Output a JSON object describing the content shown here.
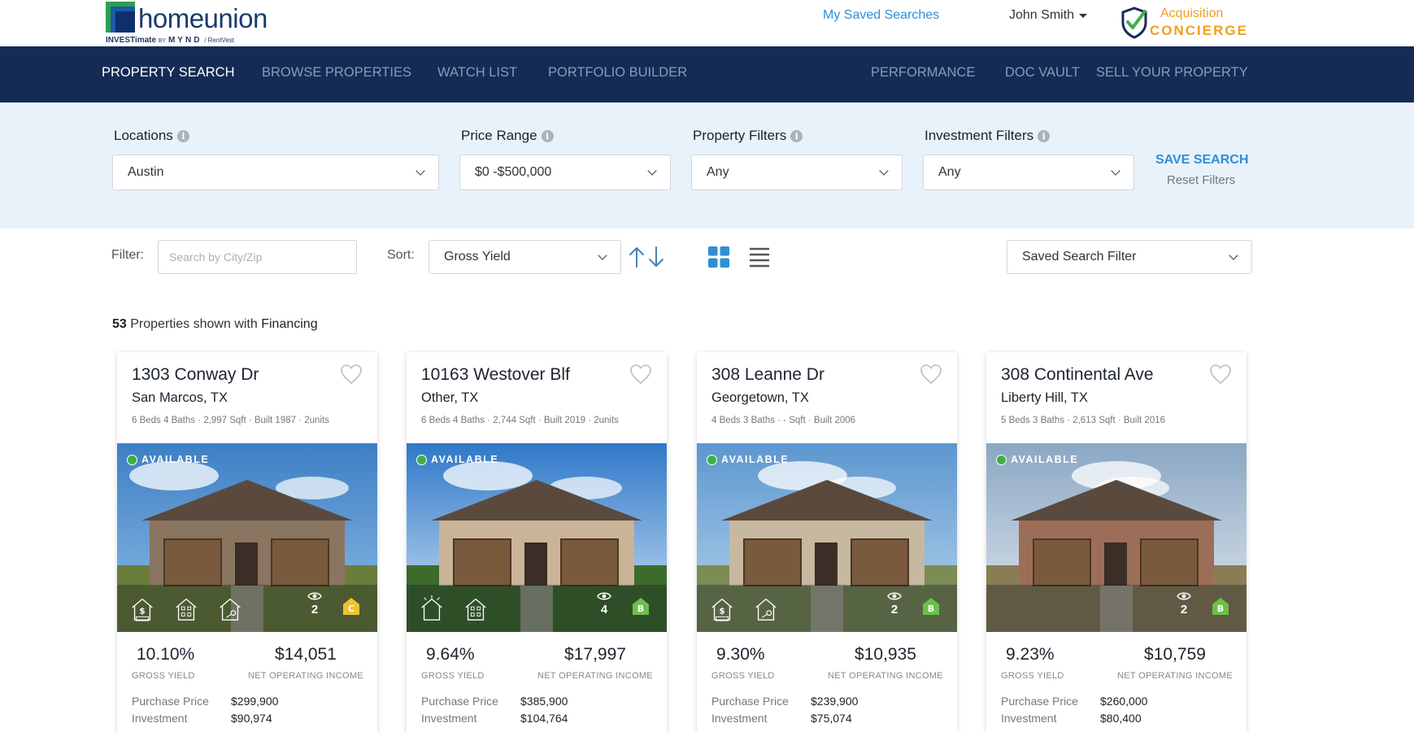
{
  "header": {
    "logo_wordmark": "homeunion",
    "logo_tag_investimate": "INVESTimate",
    "logo_tag_by": "BY",
    "logo_tag_mynd": "MYND",
    "logo_tag_rentvest": "/ RentVest",
    "saved_searches": "My Saved Searches",
    "user_name": "John Smith",
    "concierge_line1": "Acquisition",
    "concierge_line2": "CONCIERGE"
  },
  "nav": {
    "items": [
      {
        "label": "PROPERTY SEARCH",
        "active": true
      },
      {
        "label": "BROWSE PROPERTIES",
        "active": false
      },
      {
        "label": "WATCH LIST",
        "active": false
      },
      {
        "label": "PORTFOLIO BUILDER",
        "active": false
      },
      {
        "label": "PERFORMANCE",
        "active": false
      },
      {
        "label": "DOC VAULT",
        "active": false
      },
      {
        "label": "SELL YOUR PROPERTY",
        "active": false
      }
    ]
  },
  "filters": {
    "locations": {
      "label": "Locations",
      "value": "Austin"
    },
    "price_range": {
      "label": "Price Range",
      "value": "$0 -$500,000"
    },
    "property_filters": {
      "label": "Property Filters",
      "value": "Any"
    },
    "investment_filters": {
      "label": "Investment Filters",
      "value": "Any"
    },
    "save_search": "SAVE SEARCH",
    "reset_filters": "Reset Filters",
    "info_glyph": "i"
  },
  "toolbar": {
    "filter_label": "Filter:",
    "filter_placeholder": "Search by City/Zip",
    "sort_label": "Sort:",
    "sort_value": "Gross Yield",
    "saved_search_filter": "Saved Search Filter"
  },
  "results": {
    "count": "53",
    "text_middle": "Properties shown with",
    "mode": "Financing"
  },
  "cards": [
    {
      "address": "1303 Conway Dr",
      "city": "San Marcos, TX",
      "specs": "6 Beds 4 Baths · 2,997 Sqft · Built 1987 · 2units",
      "status": "AVAILABLE",
      "views": "2",
      "grade": "C",
      "grade_color": "#f2c230",
      "gross_yield": "10.10%",
      "gross_yield_label": "GROSS YIELD",
      "noi": "$14,051",
      "noi_label": "NET OPERATING INCOME",
      "purchase_price_label": "Purchase Price",
      "purchase_price": "$299,900",
      "investment_label": "Investment",
      "investment": "$90,974"
    },
    {
      "address": "10163 Westover Blf",
      "city": "Other, TX",
      "specs": "6 Beds 4 Baths · 2,744 Sqft · Built 2019 · 2units",
      "status": "AVAILABLE",
      "views": "4",
      "grade": "B",
      "grade_color": "#6cc04a",
      "gross_yield": "9.64%",
      "gross_yield_label": "GROSS YIELD",
      "noi": "$17,997",
      "noi_label": "NET OPERATING INCOME",
      "purchase_price_label": "Purchase Price",
      "purchase_price": "$385,900",
      "investment_label": "Investment",
      "investment": "$104,764"
    },
    {
      "address": "308 Leanne Dr",
      "city": "Georgetown, TX",
      "specs": "4 Beds 3 Baths · - Sqft · Built 2006",
      "status": "AVAILABLE",
      "views": "2",
      "grade": "B",
      "grade_color": "#6cc04a",
      "gross_yield": "9.30%",
      "gross_yield_label": "GROSS YIELD",
      "noi": "$10,935",
      "noi_label": "NET OPERATING INCOME",
      "purchase_price_label": "Purchase Price",
      "purchase_price": "$239,900",
      "investment_label": "Investment",
      "investment": "$75,074"
    },
    {
      "address": "308 Continental Ave",
      "city": "Liberty Hill, TX",
      "specs": "5 Beds 3 Baths · 2,613 Sqft · Built 2016",
      "status": "AVAILABLE",
      "views": "2",
      "grade": "B",
      "grade_color": "#6cc04a",
      "gross_yield": "9.23%",
      "gross_yield_label": "GROSS YIELD",
      "noi": "$10,759",
      "noi_label": "NET OPERATING INCOME",
      "purchase_price_label": "Purchase Price",
      "purchase_price": "$260,000",
      "investment_label": "Investment",
      "investment": "$80,400"
    }
  ],
  "colors": {
    "nav_bg": "#142b55",
    "accent_blue": "#2f8fd6",
    "concierge_orange": "#f0a01f",
    "filter_panel_bg": "#e9f2fa",
    "available_green": "#3fae4a"
  }
}
